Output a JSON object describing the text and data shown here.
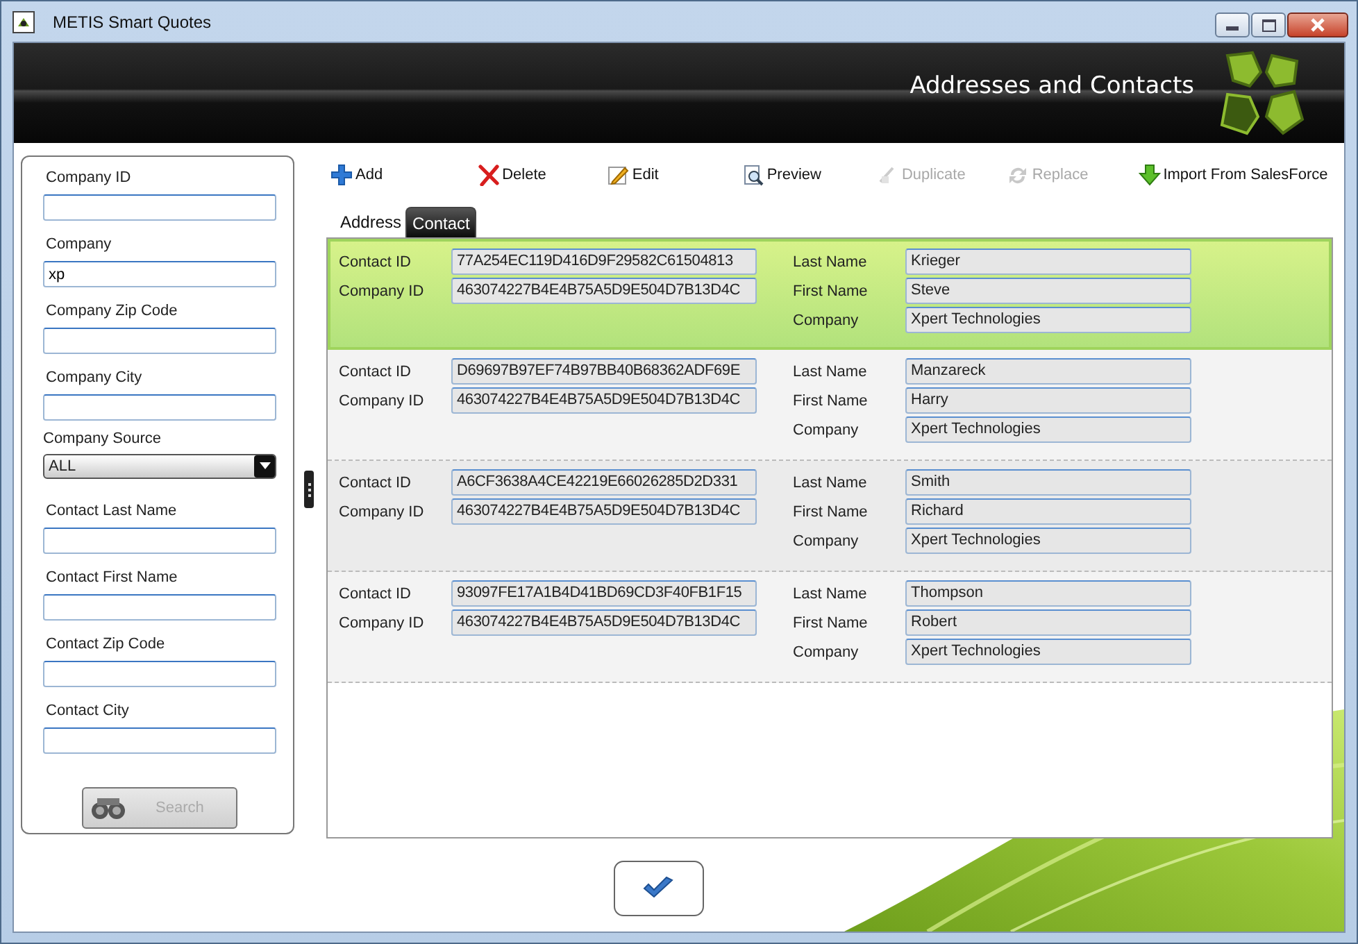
{
  "window": {
    "title": "METIS Smart Quotes"
  },
  "header": {
    "title": "Addresses and Contacts"
  },
  "search_panel": {
    "fields": [
      {
        "kind": "text",
        "label": "Company ID"
      },
      {
        "kind": "text",
        "label": "Company",
        "value": "xp"
      },
      {
        "kind": "text",
        "label": "Company Zip Code"
      },
      {
        "kind": "text",
        "label": "Company City"
      },
      {
        "kind": "select",
        "label": "Company Source",
        "value": "ALL"
      },
      {
        "kind": "text",
        "label": "Contact Last Name"
      },
      {
        "kind": "text",
        "label": "Contact First Name"
      },
      {
        "kind": "text",
        "label": "Contact Zip Code"
      },
      {
        "kind": "text",
        "label": "Contact City"
      }
    ],
    "search_button": {
      "label": "Search",
      "disabled": true
    }
  },
  "toolbar": [
    {
      "kind": "add",
      "label": "Add",
      "disabled": false
    },
    {
      "kind": "delete",
      "label": "Delete",
      "disabled": false
    },
    {
      "kind": "edit",
      "label": "Edit",
      "disabled": false
    },
    {
      "kind": "preview",
      "label": "Preview",
      "disabled": false
    },
    {
      "kind": "duplicate",
      "label": "Duplicate",
      "disabled": true
    },
    {
      "kind": "replace",
      "label": "Replace",
      "disabled": true
    },
    {
      "kind": "import",
      "label": "Import From SalesForce",
      "disabled": false
    }
  ],
  "tabs": [
    {
      "label": "Address",
      "selected": false
    },
    {
      "label": "Contact",
      "selected": true
    }
  ],
  "contacts": [
    {
      "selected": true,
      "contact_id_label": "Contact ID",
      "contact_id": "77A254EC119D416D9F29582C61504813",
      "company_id_label": "Company ID",
      "company_id": "463074227B4E4B75A5D9E504D7B13D4C",
      "last_name_label": "Last Name",
      "last_name": "Krieger",
      "first_name_label": "First Name",
      "first_name": "Steve",
      "company_label": "Company",
      "company": "Xpert Technologies"
    },
    {
      "selected": false,
      "contact_id_label": "Contact ID",
      "contact_id": "D69697B97EF74B97BB40B68362ADF69E",
      "company_id_label": "Company ID",
      "company_id": "463074227B4E4B75A5D9E504D7B13D4C",
      "last_name_label": "Last Name",
      "last_name": "Manzareck",
      "first_name_label": "First Name",
      "first_name": "Harry",
      "company_label": "Company",
      "company": "Xpert Technologies"
    },
    {
      "selected": false,
      "contact_id_label": "Contact ID",
      "contact_id": "A6CF3638A4CE42219E66026285D2D331",
      "company_id_label": "Company ID",
      "company_id": "463074227B4E4B75A5D9E504D7B13D4C",
      "last_name_label": "Last Name",
      "last_name": "Smith",
      "first_name_label": "First Name",
      "first_name": "Richard",
      "company_label": "Company",
      "company": "Xpert Technologies"
    },
    {
      "selected": false,
      "contact_id_label": "Contact ID",
      "contact_id": "93097FE17A1B4D41BD69CD3F40FB1F15",
      "company_id_label": "Company ID",
      "company_id": "463074227B4E4B75A5D9E504D7B13D4C",
      "last_name_label": "Last Name",
      "last_name": "Thompson",
      "first_name_label": "First Name",
      "first_name": "Robert",
      "company_label": "Company",
      "company": "Xpert Technologies"
    }
  ]
}
